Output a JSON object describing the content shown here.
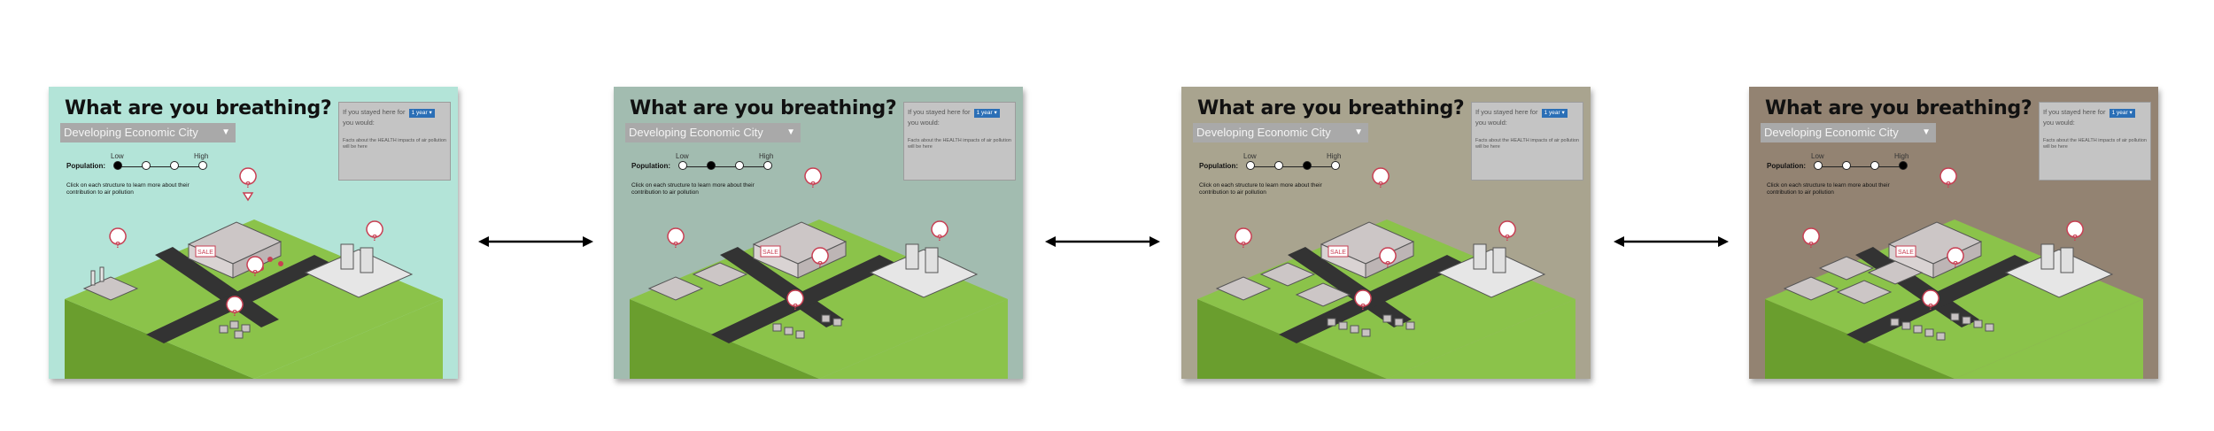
{
  "panels": [
    {
      "bg": "#b3e4d8",
      "selected": 0
    },
    {
      "bg": "#a2bcb0",
      "selected": 1
    },
    {
      "bg": "#a9a48f",
      "selected": 2
    },
    {
      "bg": "#938372",
      "selected": 3
    }
  ],
  "title": "What are you breathing?",
  "dropdown": {
    "selected": "Developing Economic City"
  },
  "population": {
    "label": "Population:",
    "low": "Low",
    "high": "High"
  },
  "instructions": "Click on each structure to learn more about their contribution to air pollution",
  "info": {
    "prefix": "If you stayed here for",
    "duration": "1 year",
    "suffix": "you would:",
    "facts": "Facts about the HEALTH impacts of air pollution will be here"
  },
  "scene": {
    "shop_sign": "SALE",
    "marker": "?"
  },
  "icons": {
    "dropdown": "chevron-down-icon",
    "marker": "map-pin-icon",
    "connector": "double-arrow-icon"
  },
  "colors": {
    "accent": "#2b6fb6",
    "grass": "#8bc34a",
    "road": "#333333",
    "marker": "#c83f53"
  }
}
